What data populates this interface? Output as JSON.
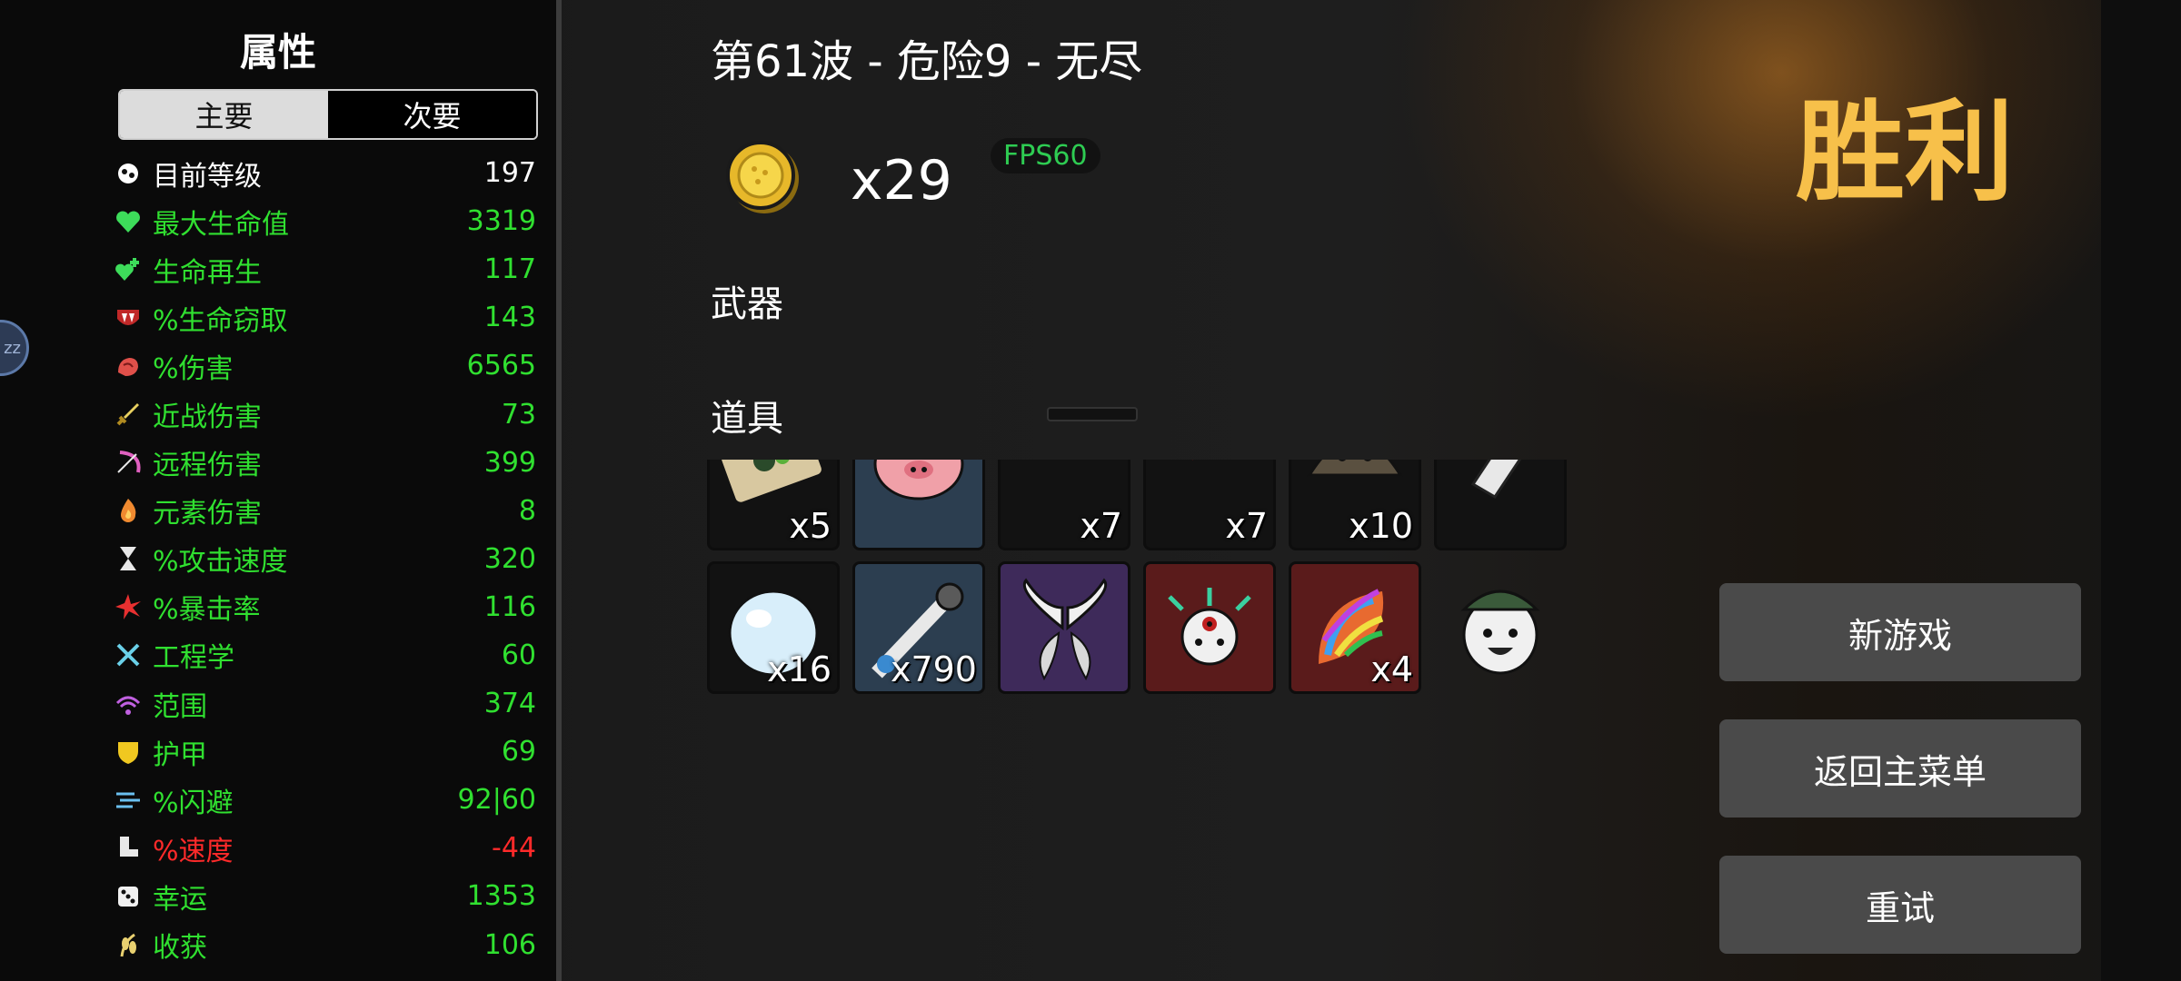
{
  "stats_panel": {
    "title": "属性",
    "tabs": [
      {
        "label": "主要",
        "active": true
      },
      {
        "label": "次要",
        "active": false
      }
    ],
    "stats": [
      {
        "label": "目前等级",
        "value": "197",
        "color": "#ffffff",
        "icon": "level-icon"
      },
      {
        "label": "最大生命值",
        "value": "3319",
        "color": "#30e030",
        "icon": "heart-icon"
      },
      {
        "label": "生命再生",
        "value": "117",
        "color": "#30e030",
        "icon": "regen-icon"
      },
      {
        "label": "%生命窃取",
        "value": "143",
        "color": "#30e030",
        "icon": "fang-icon"
      },
      {
        "label": "%伤害",
        "value": "6565",
        "color": "#30e030",
        "icon": "muscle-icon"
      },
      {
        "label": "近战伤害",
        "value": "73",
        "color": "#30e030",
        "icon": "sword-icon"
      },
      {
        "label": "远程伤害",
        "value": "399",
        "color": "#30e030",
        "icon": "bow-icon"
      },
      {
        "label": "元素伤害",
        "value": "8",
        "color": "#30e030",
        "icon": "flame-icon"
      },
      {
        "label": "%攻击速度",
        "value": "320",
        "color": "#30e030",
        "icon": "hourglass-icon"
      },
      {
        "label": "%暴击率",
        "value": "116",
        "color": "#30e030",
        "icon": "crit-icon"
      },
      {
        "label": "工程学",
        "value": "60",
        "color": "#30e030",
        "icon": "wrench-icon"
      },
      {
        "label": "范围",
        "value": "374",
        "color": "#30e030",
        "icon": "range-icon"
      },
      {
        "label": "护甲",
        "value": "69",
        "color": "#30e030",
        "icon": "shield-icon"
      },
      {
        "label": "%闪避",
        "value": "92|60",
        "color": "#30e030",
        "icon": "dodge-icon"
      },
      {
        "label": "%速度",
        "value": "-44",
        "color": "#ff2a2a",
        "icon": "boot-icon"
      },
      {
        "label": "幸运",
        "value": "1353",
        "color": "#30e030",
        "icon": "dice-icon"
      },
      {
        "label": "收获",
        "value": "106",
        "color": "#30e030",
        "icon": "harvest-icon"
      }
    ]
  },
  "sleep_badge": "zz",
  "wave": {
    "title": "第61波 - 危险9 - 无尽"
  },
  "currency": {
    "count": "x29",
    "icon": "coin-icon"
  },
  "fps": "FPS60",
  "sections": {
    "weapons": "武器",
    "items": "道具"
  },
  "items": [
    {
      "name": "ticket-item",
      "count": "x5",
      "bg": "dark"
    },
    {
      "name": "piggy-bank-item",
      "count": "",
      "bg": "blue"
    },
    {
      "name": "glasses-item",
      "count": "x7",
      "bg": "dark"
    },
    {
      "name": "red-claw-item",
      "count": "x7",
      "bg": "dark"
    },
    {
      "name": "mushroom-item",
      "count": "x10",
      "bg": "dark"
    },
    {
      "name": "pencil-item",
      "count": "",
      "bg": "dark"
    },
    {
      "name": "snowball-item",
      "count": "x16",
      "bg": "dark"
    },
    {
      "name": "turret-item",
      "count": "x790",
      "bg": "blue"
    },
    {
      "name": "angel-wings-item",
      "count": "",
      "bg": "purple"
    },
    {
      "name": "spiky-creature-item",
      "count": "",
      "bg": "red"
    },
    {
      "name": "rainbow-leaf-item",
      "count": "x4",
      "bg": "red"
    },
    {
      "name": "potato-face-item",
      "count": "",
      "bg": "none"
    }
  ],
  "victory": "胜利",
  "buttons": {
    "new_game": "新游戏",
    "main_menu": "返回主菜单",
    "retry": "重试"
  },
  "colors": {
    "accent_gold": "#f7c04a",
    "stat_green": "#30e030",
    "stat_red": "#ff2a2a",
    "fps_green": "#2ecc52"
  }
}
